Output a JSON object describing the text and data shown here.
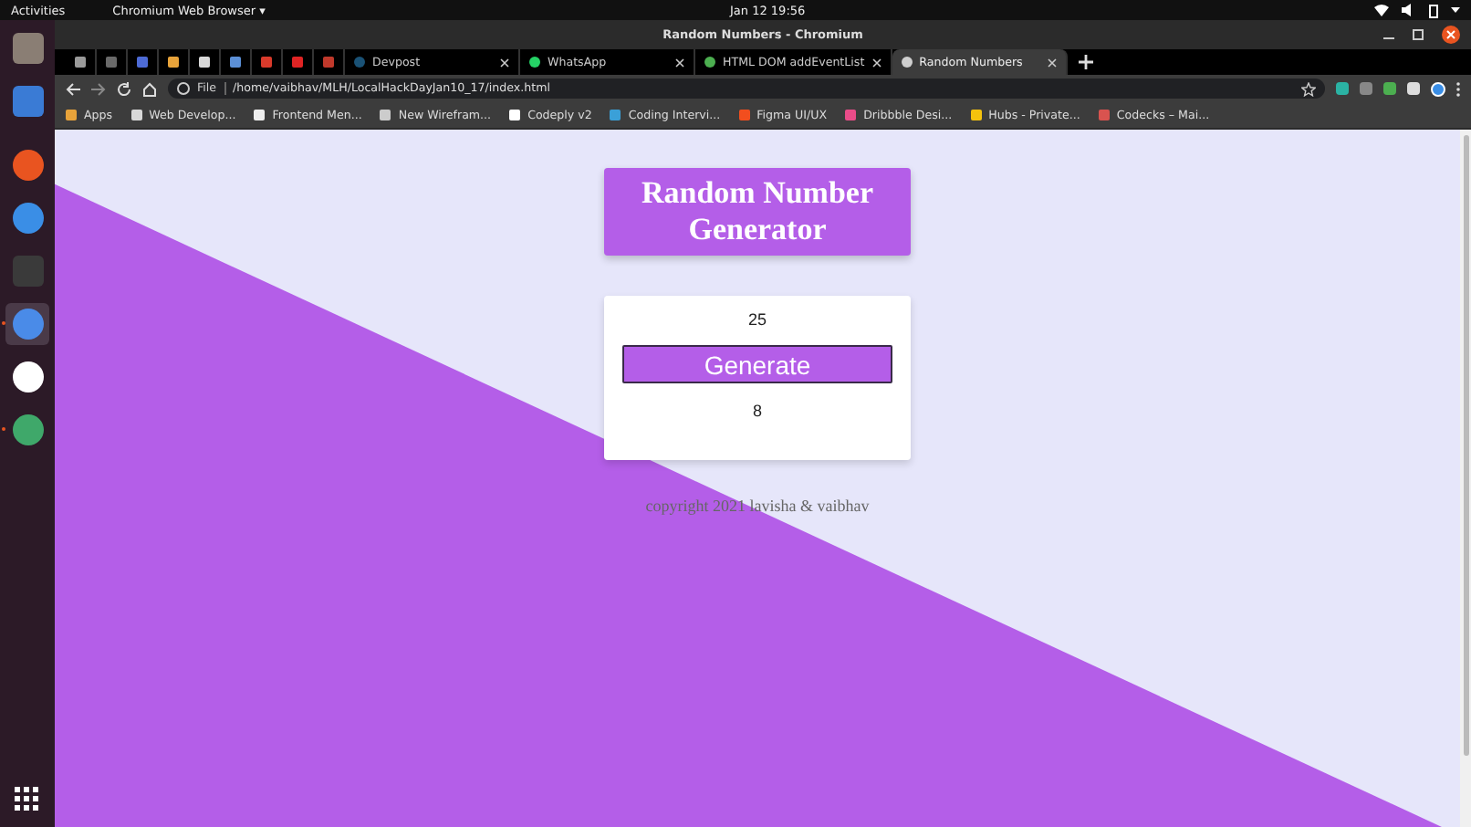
{
  "top_bar": {
    "activities": "Activities",
    "app_menu": "Chromium Web Browser ▾",
    "clock": "Jan 12  19:56"
  },
  "dock": [
    {
      "kind": "files",
      "running": false,
      "selected": false
    },
    {
      "kind": "writer",
      "running": false,
      "selected": false
    },
    {
      "kind": "software",
      "running": false,
      "selected": false
    },
    {
      "kind": "help",
      "running": false,
      "selected": false
    },
    {
      "kind": "terminal",
      "running": false,
      "selected": false
    },
    {
      "kind": "chromium",
      "running": true,
      "selected": true
    },
    {
      "kind": "slack",
      "running": false,
      "selected": false
    },
    {
      "kind": "green",
      "running": true,
      "selected": false
    }
  ],
  "window": {
    "title": "Random Numbers - Chromium"
  },
  "pinned_tabs": [
    {
      "color": "#9a9a9a"
    },
    {
      "color": "#6a6a6a"
    },
    {
      "color": "#4d6bd6"
    },
    {
      "color": "#e8a33a"
    },
    {
      "color": "#d8d8d8"
    },
    {
      "color": "#5b8fd6"
    },
    {
      "color": "#d93a2b"
    },
    {
      "color": "#e02424"
    },
    {
      "color": "#c0392b"
    }
  ],
  "tabs": [
    {
      "label": "Devpost",
      "selected": false,
      "color": "#1a5276"
    },
    {
      "label": "WhatsApp",
      "selected": false,
      "color": "#25d366"
    },
    {
      "label": "HTML DOM addEventList",
      "selected": false,
      "color": "#4caf50"
    },
    {
      "label": "Random Numbers",
      "selected": true,
      "color": "#cfcfcf"
    }
  ],
  "address": {
    "scheme": "File",
    "path": "/home/vaibhav/MLH/LocalHackDayJan10_17/index.html"
  },
  "bookmarks": [
    {
      "label": "Apps",
      "color": "#e8a33a"
    },
    {
      "label": "Web Develop...",
      "color": "#d8d8d8"
    },
    {
      "label": "Frontend Men...",
      "color": "#eeeeee"
    },
    {
      "label": "New Wirefram...",
      "color": "#cccccc"
    },
    {
      "label": "Codeply v2",
      "color": "#ffffff"
    },
    {
      "label": "Coding Intervi...",
      "color": "#3aa0d8"
    },
    {
      "label": "Figma UI/UX",
      "color": "#f24e1e"
    },
    {
      "label": "Dribbble Desi...",
      "color": "#ea4c89"
    },
    {
      "label": "Hubs - Private...",
      "color": "#f4c20d"
    },
    {
      "label": "Codecks – Mai...",
      "color": "#d9534f"
    }
  ],
  "page": {
    "heading": "Random Number Generator",
    "input": {
      "value": "25"
    },
    "button": "Generate",
    "result": "8",
    "footer": "copyright 2021 lavisha & vaibhav"
  }
}
